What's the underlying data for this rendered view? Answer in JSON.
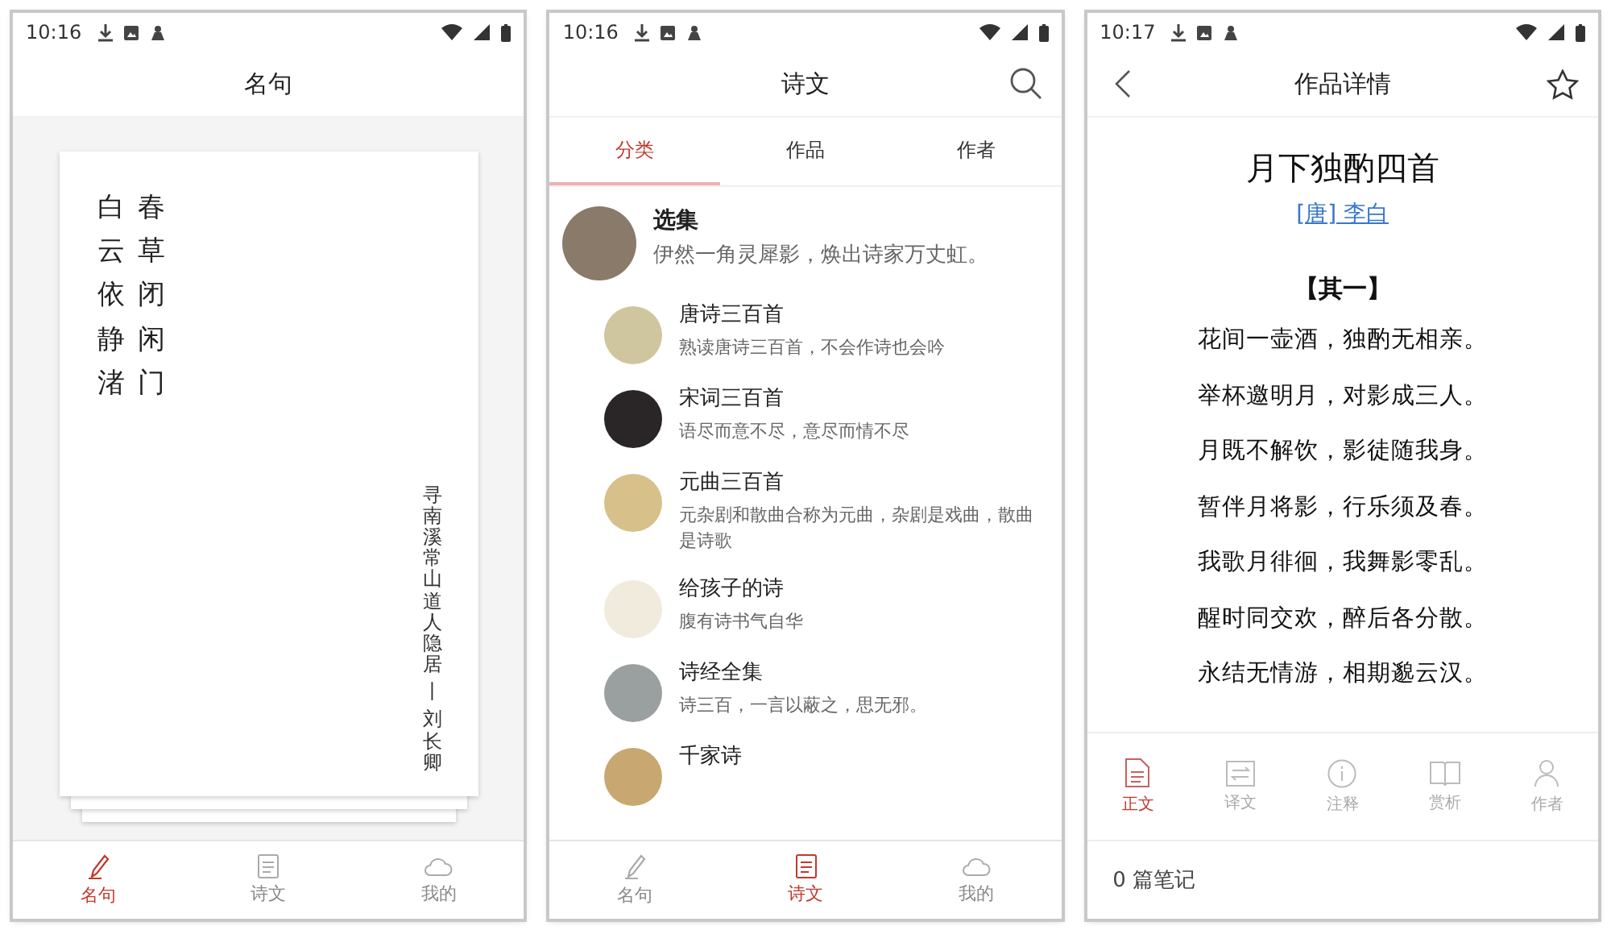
{
  "screens": [
    {
      "kind": "quote",
      "time": "10:16",
      "title": "名句",
      "quote": {
        "columns": [
          "白云依静渚",
          "春草闭闲门"
        ],
        "source": "寻南溪常山道人隐居",
        "separator": "丨",
        "author": "刘长卿"
      },
      "nav": [
        {
          "label": "名句",
          "selected": true
        },
        {
          "label": "诗文",
          "selected": false
        },
        {
          "label": "我的",
          "selected": false
        }
      ]
    },
    {
      "kind": "list",
      "time": "10:16",
      "title": "诗文",
      "tabs": [
        {
          "label": "分类",
          "selected": true
        },
        {
          "label": "作品",
          "selected": false
        },
        {
          "label": "作者",
          "selected": false
        }
      ],
      "featured": {
        "title": "选集",
        "subtitle": "伊然一角灵犀影，焕出诗家万丈虹。",
        "color": "#8a7a6a"
      },
      "items": [
        {
          "title": "唐诗三百首",
          "subtitle": "熟读唐诗三百首，不会作诗也会吟",
          "color": "#cfc6a0"
        },
        {
          "title": "宋词三百首",
          "subtitle": "语尽而意不尽，意尽而情不尽",
          "color": "#2a2628"
        },
        {
          "title": "元曲三百首",
          "subtitle": "元杂剧和散曲合称为元曲，杂剧是戏曲，散曲是诗歌",
          "color": "#d8c08a"
        },
        {
          "title": "给孩子的诗",
          "subtitle": "腹有诗书气自华",
          "color": "#f0ebdc"
        },
        {
          "title": "诗经全集",
          "subtitle": "诗三百，一言以蔽之，思无邪。",
          "color": "#9aa0a0"
        },
        {
          "title": "千家诗",
          "color": "#c8a870"
        }
      ],
      "nav": [
        {
          "label": "名句",
          "selected": false
        },
        {
          "label": "诗文",
          "selected": true
        },
        {
          "label": "我的",
          "selected": false
        }
      ]
    },
    {
      "kind": "detail",
      "time": "10:17",
      "title": "作品详情",
      "poem": {
        "title": "月下独酌四首",
        "author": "[唐] 李白",
        "section": "【其一】",
        "lines": [
          "花间一壶酒，独酌无相亲。",
          "举杯邀明月，对影成三人。",
          "月既不解饮，影徒随我身。",
          "暂伴月将影，行乐须及春。",
          "我歌月徘徊，我舞影零乱。",
          "醒时同交欢，醉后各分散。",
          "永结无情游，相期邈云汉。"
        ]
      },
      "toolbar": [
        {
          "label": "正文",
          "selected": true
        },
        {
          "label": "译文",
          "selected": false
        },
        {
          "label": "注释",
          "selected": false
        },
        {
          "label": "赏析",
          "selected": false
        },
        {
          "label": "作者",
          "selected": false
        }
      ],
      "notes": "0 篇笔记"
    }
  ]
}
